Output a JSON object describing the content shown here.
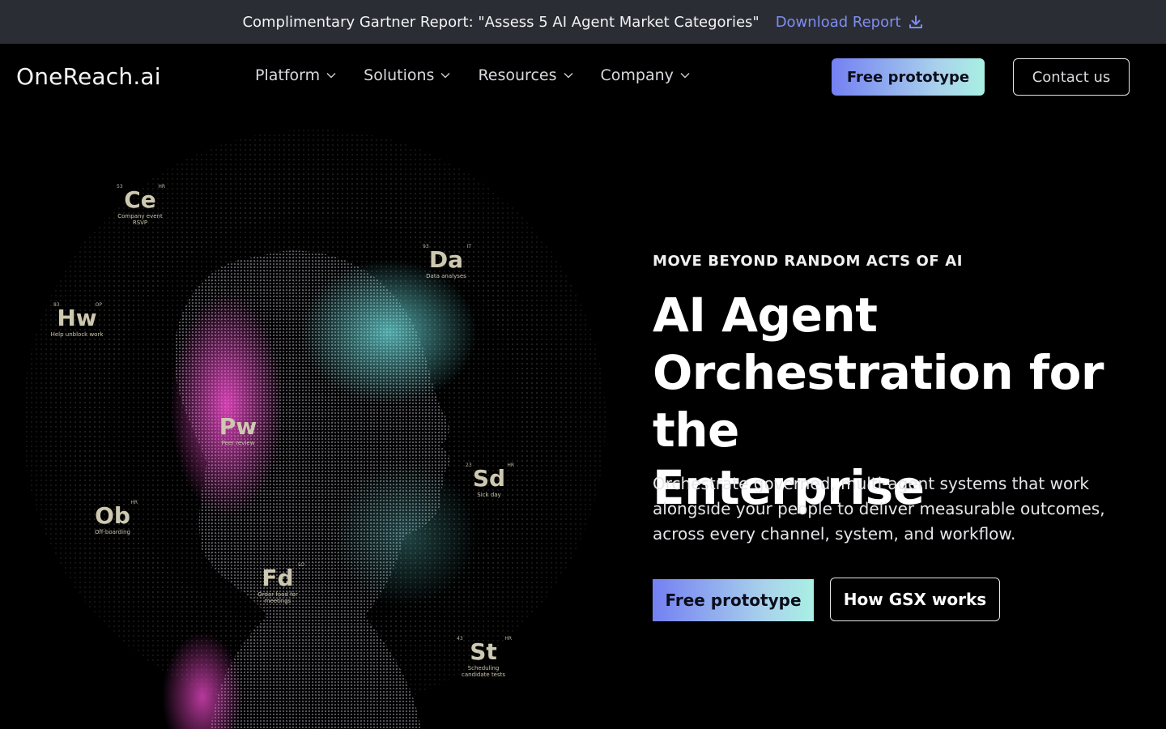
{
  "announcement": {
    "message": "Complimentary Gartner Report: \"Assess 5 AI Agent Market Categories\"",
    "link_label": "Download Report",
    "link_icon": "download-icon"
  },
  "nav": {
    "logo": "OneReach.ai",
    "menu": [
      {
        "label": "Platform",
        "icon": "chevron-down-icon"
      },
      {
        "label": "Solutions",
        "icon": "chevron-down-icon"
      },
      {
        "label": "Resources",
        "icon": "chevron-down-icon"
      },
      {
        "label": "Company",
        "icon": "chevron-down-icon"
      }
    ],
    "primary_cta": "Free prototype",
    "secondary_cta": "Contact us"
  },
  "hero": {
    "eyebrow": "MOVE BEYOND RANDOM ACTS OF AI",
    "headline_lines": [
      "AI Agent",
      "Orchestration for the",
      "Enterprise"
    ],
    "subtext": "Orchestrate governed, multi-agent systems that work alongside your people to deliver measurable outcomes, across every channel, system, and workflow.",
    "primary_cta": "Free prototype",
    "secondary_cta": "How GSX works"
  },
  "art_elements": [
    {
      "symbol": "Ce",
      "caption": "Company event RSVP",
      "num": "53",
      "tag": "HR"
    },
    {
      "symbol": "Da",
      "caption": "Data analyses",
      "num": "93",
      "tag": "IT"
    },
    {
      "symbol": "Hw",
      "caption": "Help unblock work",
      "num": "83",
      "tag": "OP"
    },
    {
      "symbol": "Pw",
      "caption": "Peer review",
      "num": "",
      "tag": ""
    },
    {
      "symbol": "Sd",
      "caption": "Sick day",
      "num": "23",
      "tag": "HR"
    },
    {
      "symbol": "Ob",
      "caption": "Off-boarding",
      "num": "",
      "tag": "HR"
    },
    {
      "symbol": "Fd",
      "caption": "Order food for meetings",
      "num": "",
      "tag": "LO"
    },
    {
      "symbol": "St",
      "caption": "Scheduling candidate tests",
      "num": "43",
      "tag": "HR"
    }
  ],
  "colors": {
    "announce_bg": "#2b2d35",
    "link": "#7f8ef0",
    "grad_start": "#7480f2",
    "grad_end": "#a9f0e3",
    "particle_pink": "#ff4fd8",
    "particle_cyan": "#6fe6e6"
  }
}
